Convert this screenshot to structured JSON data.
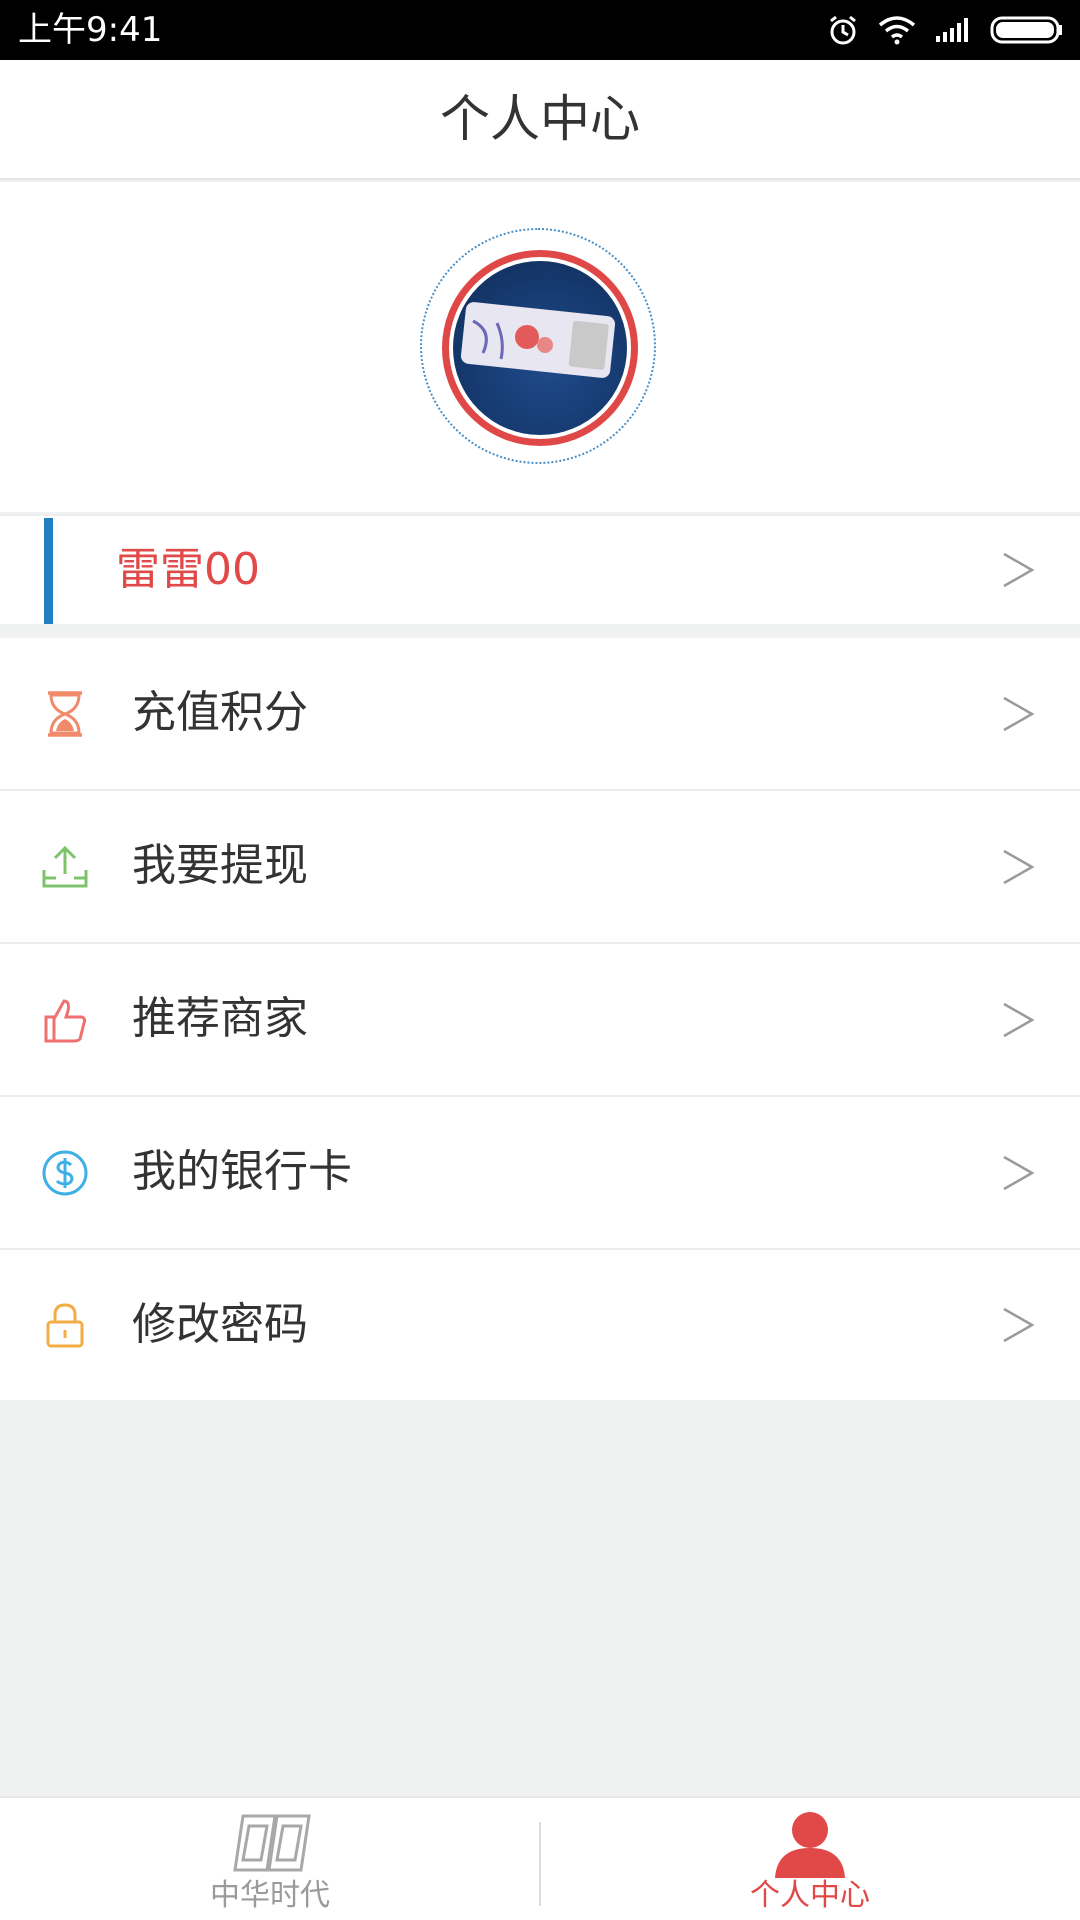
{
  "status_bar": {
    "time": "上午9:41",
    "icons": [
      "alarm-icon",
      "wifi-icon",
      "signal-icon",
      "battery-icon"
    ]
  },
  "header": {
    "title": "个人中心"
  },
  "profile": {
    "username": "雷雷00",
    "colors": {
      "accent_red": "#e14848",
      "accent_blue": "#1f7fc2"
    }
  },
  "menu": {
    "items": [
      {
        "label": "充值积分",
        "icon": "hourglass-icon",
        "color": "#f08a6a"
      },
      {
        "label": "我要提现",
        "icon": "upload-icon",
        "color": "#7cc36c"
      },
      {
        "label": "推荐商家",
        "icon": "thumbs-up-icon",
        "color": "#f07070"
      },
      {
        "label": "我的银行卡",
        "icon": "dollar-icon",
        "color": "#3fb0e6"
      },
      {
        "label": "修改密码",
        "icon": "lock-icon",
        "color": "#f3ad45"
      }
    ]
  },
  "tabbar": {
    "tabs": [
      {
        "label": "中华时代",
        "icon": "logo-icon",
        "active": false,
        "color": "#9a9a9a"
      },
      {
        "label": "个人中心",
        "icon": "person-icon",
        "active": true,
        "color": "#e14848"
      }
    ]
  }
}
